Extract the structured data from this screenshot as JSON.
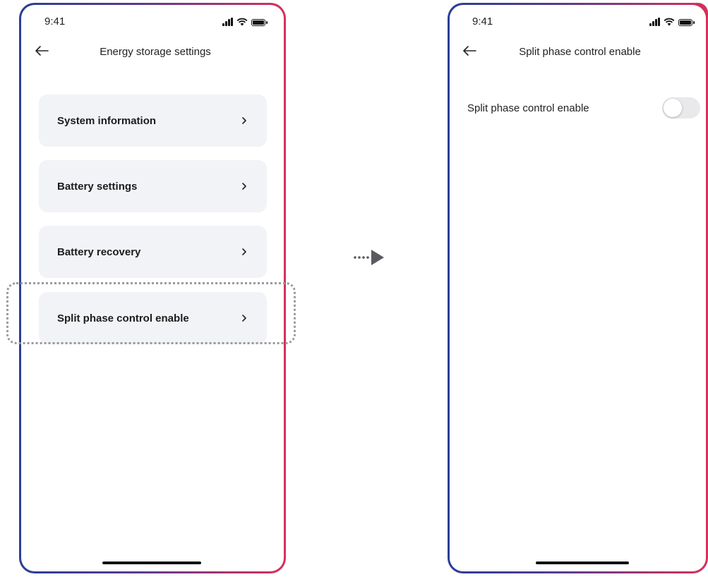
{
  "left_screen": {
    "status_time": "9:41",
    "title": "Energy storage settings",
    "menu_items": [
      {
        "label": "System information"
      },
      {
        "label": "Battery settings"
      },
      {
        "label": "Battery recovery"
      },
      {
        "label": "Split phase control enable"
      }
    ],
    "highlighted_item": "Split phase control enable"
  },
  "right_screen": {
    "status_time": "9:41",
    "title": "Split phase control enable",
    "setting": {
      "label": "Split phase control enable",
      "enabled": false
    }
  },
  "colors": {
    "frame_start": "#2a3f96",
    "frame_end": "#d8305a",
    "card_background": "#f1f3f6",
    "toggle_off": "#e9e9ec"
  },
  "icons": [
    "back-arrow-icon",
    "chevron-right-icon",
    "signal-icon",
    "wifi-icon",
    "battery-icon",
    "flow-arrow-icon"
  ]
}
